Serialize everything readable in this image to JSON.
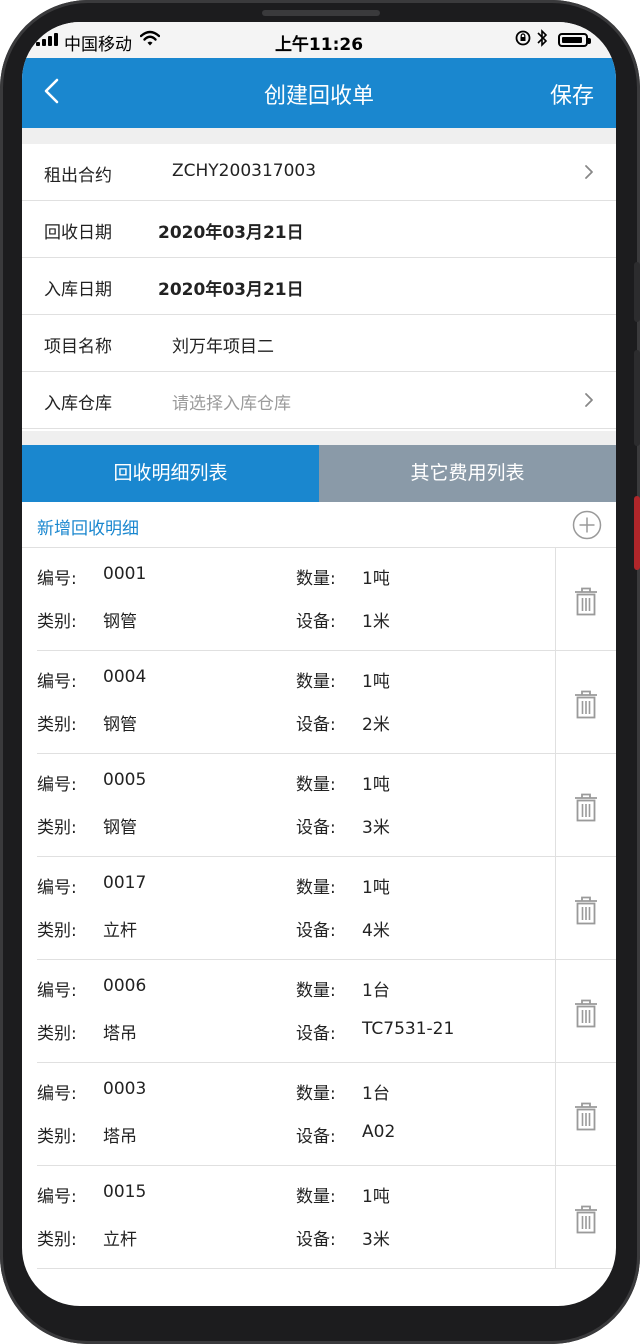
{
  "status_bar": {
    "carrier": "中国移动",
    "time": "上午11:26",
    "icons": [
      "signal-icon",
      "wifi-icon",
      "rotation-lock-icon",
      "bluetooth-icon",
      "battery-icon"
    ]
  },
  "nav": {
    "title": "创建回收单",
    "save_label": "保存",
    "back_icon": "chevron-left-icon"
  },
  "form": {
    "rows": [
      {
        "label": "租出合约",
        "value": "ZCHY200317003",
        "has_arrow": true
      },
      {
        "label": "回收日期",
        "value": "2020年03月21日"
      },
      {
        "label": "入库日期",
        "value": "2020年03月21日"
      },
      {
        "label": "项目名称",
        "value": "刘万年项目二"
      },
      {
        "label": "入库仓库",
        "placeholder": "请选择入库仓库",
        "has_arrow": true
      }
    ]
  },
  "tabs": [
    {
      "label": "回收明细列表",
      "active": true
    },
    {
      "label": "其它费用列表",
      "active": false
    }
  ],
  "add_detail": {
    "label": "新增回收明细",
    "icon": "add-circle-icon"
  },
  "field_labels": {
    "number": "编号:",
    "category": "类别:",
    "quantity": "数量:",
    "device": "设备:"
  },
  "items": [
    {
      "number": "0001",
      "category": "钢管",
      "quantity": "1吨",
      "device": "1米"
    },
    {
      "number": "0004",
      "category": "钢管",
      "quantity": "1吨",
      "device": "2米"
    },
    {
      "number": "0005",
      "category": "钢管",
      "quantity": "1吨",
      "device": "3米"
    },
    {
      "number": "0017",
      "category": "立杆",
      "quantity": "1吨",
      "device": "4米"
    },
    {
      "number": "0006",
      "category": "塔吊",
      "quantity": "1台",
      "device": "TC7531-21"
    },
    {
      "number": "0003",
      "category": "塔吊",
      "quantity": "1台",
      "device": "A02"
    },
    {
      "number": "0015",
      "category": "立杆",
      "quantity": "1吨",
      "device": "3米"
    }
  ],
  "colors": {
    "primary": "#1a87cf",
    "tab_inactive": "#8a9aa8",
    "background": "#efefef"
  }
}
